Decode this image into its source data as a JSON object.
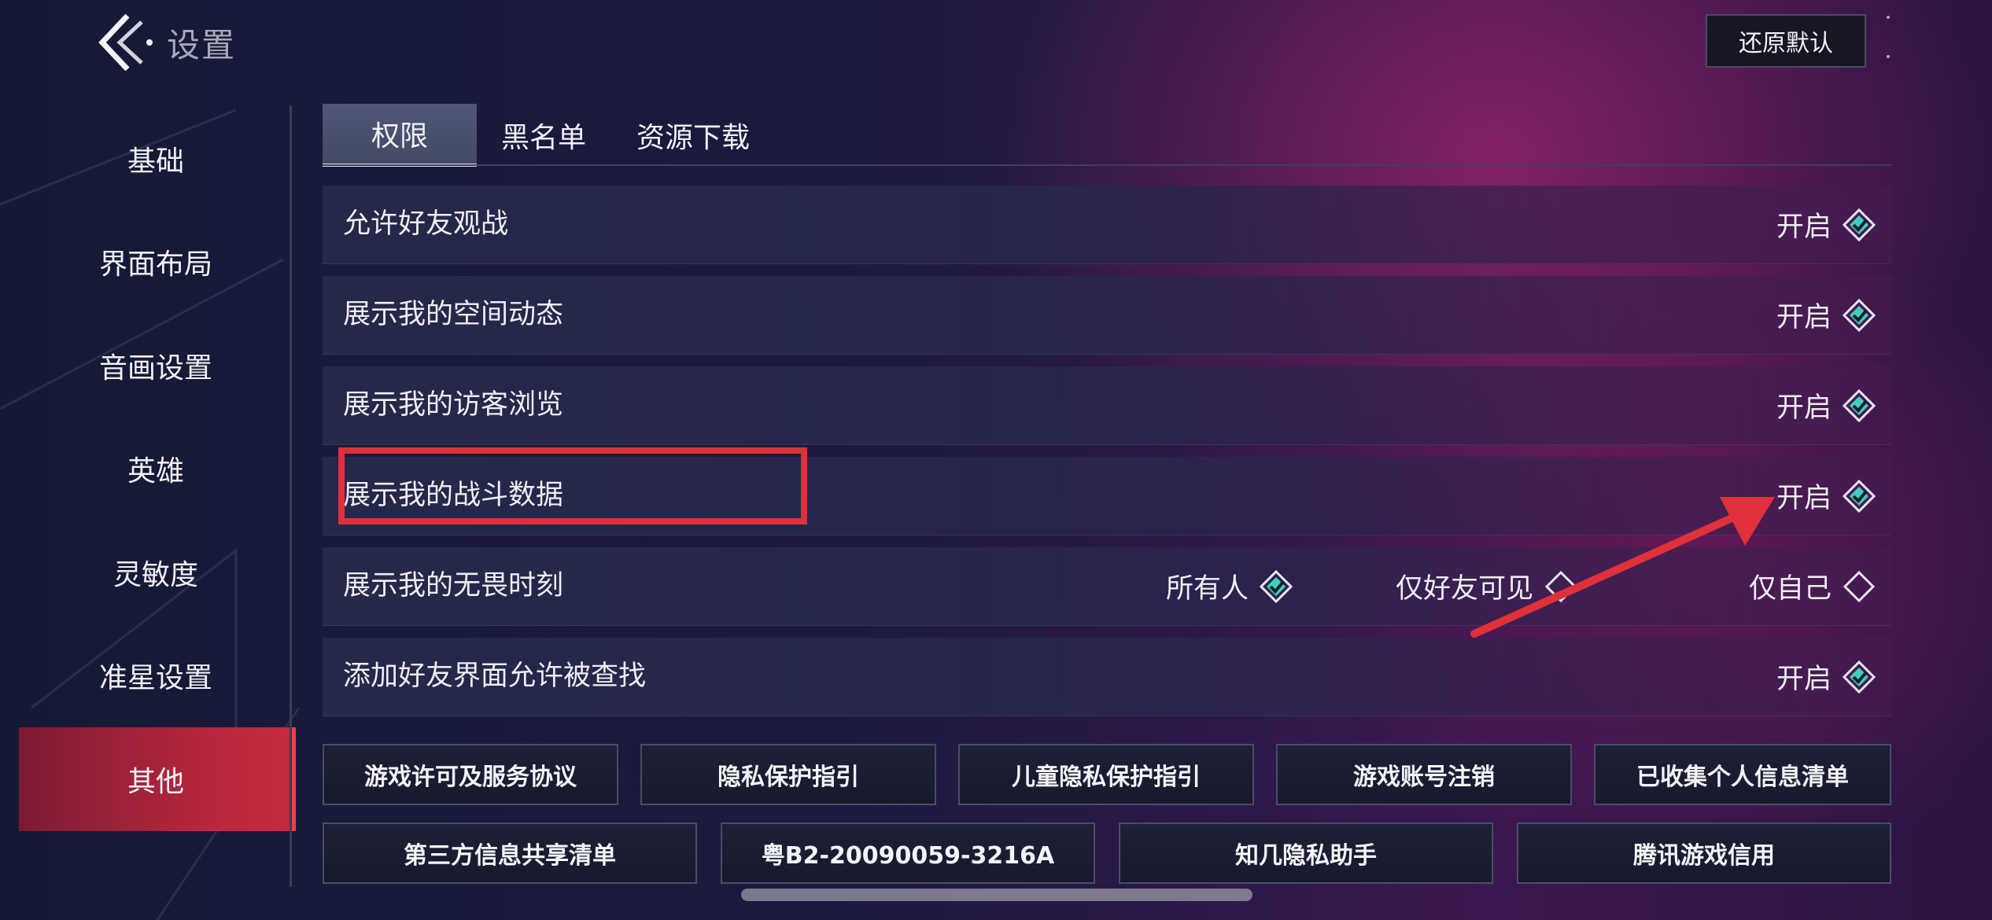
{
  "header": {
    "title": "设置",
    "reset_label": "还原默认"
  },
  "sidebar": {
    "items": [
      {
        "label": "基础"
      },
      {
        "label": "界面布局"
      },
      {
        "label": "音画设置"
      },
      {
        "label": "英雄"
      },
      {
        "label": "灵敏度"
      },
      {
        "label": "准星设置"
      },
      {
        "label": "其他",
        "active": true
      }
    ]
  },
  "tabs": [
    {
      "label": "权限",
      "active": true
    },
    {
      "label": "黑名单"
    },
    {
      "label": "资源下载"
    }
  ],
  "settings": [
    {
      "label": "允许好友观战",
      "value": "开启",
      "checked": true
    },
    {
      "label": "展示我的空间动态",
      "value": "开启",
      "checked": true
    },
    {
      "label": "展示我的访客浏览",
      "value": "开启",
      "checked": true
    },
    {
      "label": "展示我的战斗数据",
      "value": "开启",
      "checked": true
    },
    {
      "label": "展示我的无畏时刻",
      "options": [
        {
          "label": "所有人",
          "checked": true
        },
        {
          "label": "仅好友可见",
          "checked": false
        },
        {
          "label": "仅自己",
          "checked": false
        }
      ]
    },
    {
      "label": "添加好友界面允许被查找",
      "value": "开启",
      "checked": true
    }
  ],
  "links_row1": [
    {
      "label": "游戏许可及服务协议"
    },
    {
      "label": "隐私保护指引"
    },
    {
      "label": "儿童隐私保护指引"
    },
    {
      "label": "游戏账号注销"
    },
    {
      "label": "已收集个人信息清单"
    }
  ],
  "links_row2": [
    {
      "label": "第三方信息共享清单"
    },
    {
      "label": "粤B2-20090059-3216A"
    },
    {
      "label": "知几隐私助手"
    },
    {
      "label": "腾讯游戏信用"
    }
  ],
  "colors": {
    "accent_check": "#3fd0c0",
    "active_tab_bg": "#4a5170",
    "sidebar_active": "#c52a40",
    "annotation_red": "#e0303a"
  },
  "icons": {
    "back": "back-chevron-icon",
    "checked": "diamond-checked-icon",
    "unchecked": "diamond-empty-icon"
  }
}
